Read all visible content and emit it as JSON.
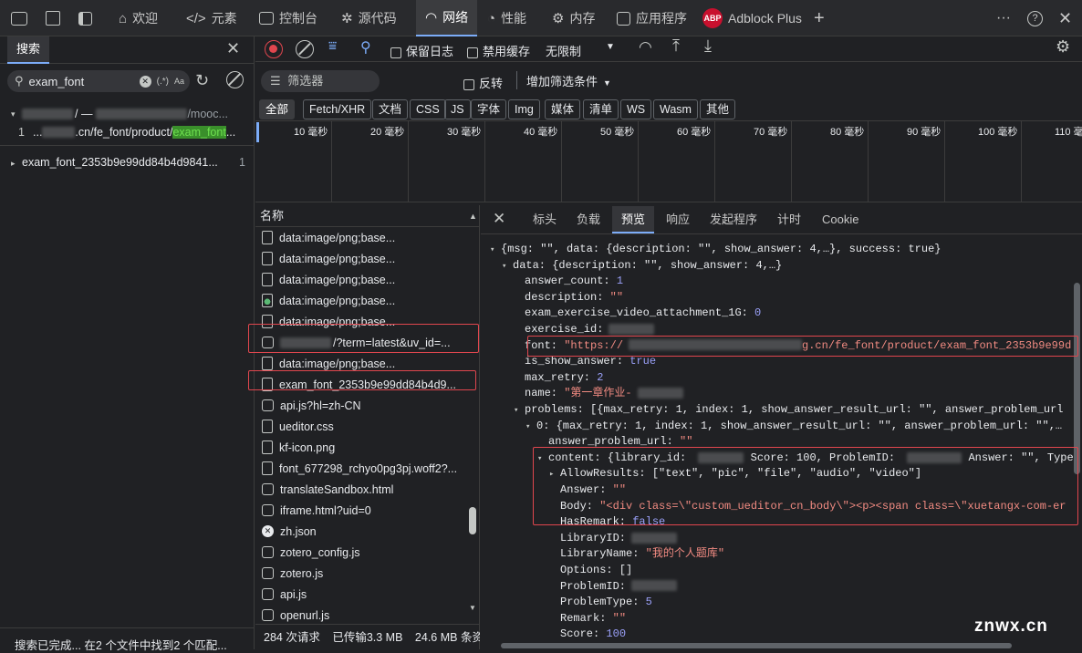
{
  "topbar": {
    "welcome": "欢迎",
    "elements": "元素",
    "console": "控制台",
    "sources": "源代码",
    "network": "网络",
    "performance": "性能",
    "memory": "内存",
    "application": "应用程序",
    "adblock": "Adblock Plus",
    "adblock_icon": "ABP"
  },
  "search_panel": {
    "tab": "搜索",
    "query": "exam_font",
    "regex_label": "(.*)",
    "case_label": "Aa",
    "results": [
      {
        "path": "/ — ",
        "path_tail": "/mooc...",
        "count": ""
      },
      {
        "line_no": "1",
        "prefix": "...",
        "text": ".cn/fe_font/product/",
        "highlight": "exam_font",
        "suffix": "..."
      },
      {
        "name": "exam_font_2353b9e99dd84b4d9841...",
        "count": "1"
      }
    ],
    "status": "搜索已完成... 在2 个文件中找到2 个匹配..."
  },
  "network_toolbar": {
    "preserve_log": "保留日志",
    "disable_cache": "禁用缓存",
    "throttle": "无限制",
    "filter_placeholder": "筛选器",
    "invert": "反转",
    "more_filters": "增加筛选条件",
    "types": [
      "全部",
      "Fetch/XHR",
      "文档",
      "CSS",
      "JS",
      "字体",
      "Img",
      "媒体",
      "清单",
      "WS",
      "Wasm",
      "其他"
    ]
  },
  "timeline": {
    "ticks": [
      "10 毫秒",
      "20 毫秒",
      "30 毫秒",
      "40 毫秒",
      "50 毫秒",
      "60 毫秒",
      "70 毫秒",
      "80 毫秒",
      "90 毫秒",
      "100 毫秒",
      "110 毫"
    ]
  },
  "request_list": {
    "header": "名称",
    "rows": [
      {
        "name": "data:image/png;base...",
        "icon": "image-file-icon"
      },
      {
        "name": "data:image/png;base...",
        "icon": "image-file-icon"
      },
      {
        "name": "data:image/png;base...",
        "icon": "file-icon"
      },
      {
        "name": "data:image/png;base...",
        "icon": "image-file-icon"
      },
      {
        "name": "data:image/png;base...",
        "icon": "file-icon"
      },
      {
        "name": "/?term=latest&uv_id=...",
        "icon": "xhr-icon"
      },
      {
        "name": "data:image/png;base...",
        "icon": "file-icon"
      },
      {
        "name": "exam_font_2353b9e99dd84b4d9...",
        "icon": "font-icon"
      },
      {
        "name": "api.js?hl=zh-CN",
        "icon": "script-icon"
      },
      {
        "name": "ueditor.css",
        "icon": "stylesheet-icon"
      },
      {
        "name": "kf-icon.png",
        "icon": "image-file-icon"
      },
      {
        "name": "font_677298_rchyo0pg3pj.woff2?...",
        "icon": "font-icon"
      },
      {
        "name": "translateSandbox.html",
        "icon": "document-icon"
      },
      {
        "name": "iframe.html?uid=0",
        "icon": "document-icon"
      },
      {
        "name": "zh.json",
        "icon": "error-icon"
      },
      {
        "name": "zotero_config.js",
        "icon": "script-icon"
      },
      {
        "name": "zotero.js",
        "icon": "script-icon"
      },
      {
        "name": "api.js",
        "icon": "script-icon"
      },
      {
        "name": "openurl.js",
        "icon": "script-icon"
      }
    ],
    "footer": {
      "requests": "284 次请求",
      "transferred": "已传输3.3 MB",
      "resources": "24.6 MB 条资"
    }
  },
  "detail_tabs": [
    "标头",
    "负载",
    "预览",
    "响应",
    "发起程序",
    "计时",
    "Cookie"
  ],
  "preview": [
    {
      "indent": 0,
      "tri": "▾",
      "text": "{msg: \"\", data: {description: \"\", show_answer: 4,…}, success: true}"
    },
    {
      "indent": 1,
      "tri": "▾",
      "key": "data:",
      "text": " {description: \"\", show_answer: 4,…}"
    },
    {
      "indent": 2,
      "key": "answer_count:",
      "num": " 1"
    },
    {
      "indent": 2,
      "key": "description:",
      "str": " \"\""
    },
    {
      "indent": 2,
      "key": "exam_exercise_video_attachment_1G:",
      "num": " 0"
    },
    {
      "indent": 2,
      "key": "exercise_id:",
      "blur": true
    },
    {
      "indent": 2,
      "key": "font:",
      "str": " \"https://",
      "blur": true,
      "str2": "g.cn/fe_font/product/exam_font_2353b9e99d"
    },
    {
      "indent": 2,
      "key": "is_show_answer:",
      "num": " true"
    },
    {
      "indent": 2,
      "key": "max_retry:",
      "num": " 2"
    },
    {
      "indent": 2,
      "key": "name:",
      "str": " \"第一章作业-",
      "blur": true
    },
    {
      "indent": 2,
      "tri": "▾",
      "key": "problems:",
      "text": " [{max_retry: 1, index: 1, show_answer_result_url: \"\", answer_problem_url"
    },
    {
      "indent": 3,
      "tri": "▾",
      "key": "0:",
      "text": " {max_retry: 1, index: 1, show_answer_result_url: \"\", answer_problem_url: \"\",…"
    },
    {
      "indent": 4,
      "key": "answer_problem_url:",
      "str": " \"\""
    },
    {
      "indent": 4,
      "tri": "▾",
      "key": "content:",
      "text": " {library_id: ",
      "blur": true,
      "text2": " Score: 100, ProblemID: ",
      "text3": " Answer: \"\", Type"
    },
    {
      "indent": 5,
      "tri": "▸",
      "key": "AllowResults:",
      "text": " [\"text\", \"pic\", \"file\", \"audio\", \"video\"]"
    },
    {
      "indent": 5,
      "key": "Answer:",
      "str": " \"\""
    },
    {
      "indent": 5,
      "key": "Body:",
      "str": " \"<div class=\\\"custom_ueditor_cn_body\\\"><p><span class=\\\"xuetangx-com-er"
    },
    {
      "indent": 5,
      "key": "HasRemark:",
      "num": " false"
    },
    {
      "indent": 5,
      "key": "LibraryID:",
      "blur": true
    },
    {
      "indent": 5,
      "key": "LibraryName:",
      "str": " \"我的个人题库\""
    },
    {
      "indent": 5,
      "key": "Options:",
      "text": " []"
    },
    {
      "indent": 5,
      "key": "ProblemID:",
      "blur": true
    },
    {
      "indent": 5,
      "key": "ProblemType:",
      "num": " 5"
    },
    {
      "indent": 5,
      "key": "Remark:",
      "str": " \"\""
    },
    {
      "indent": 5,
      "key": "Score:",
      "num": " 100"
    }
  ],
  "watermark": "znwx.cn"
}
